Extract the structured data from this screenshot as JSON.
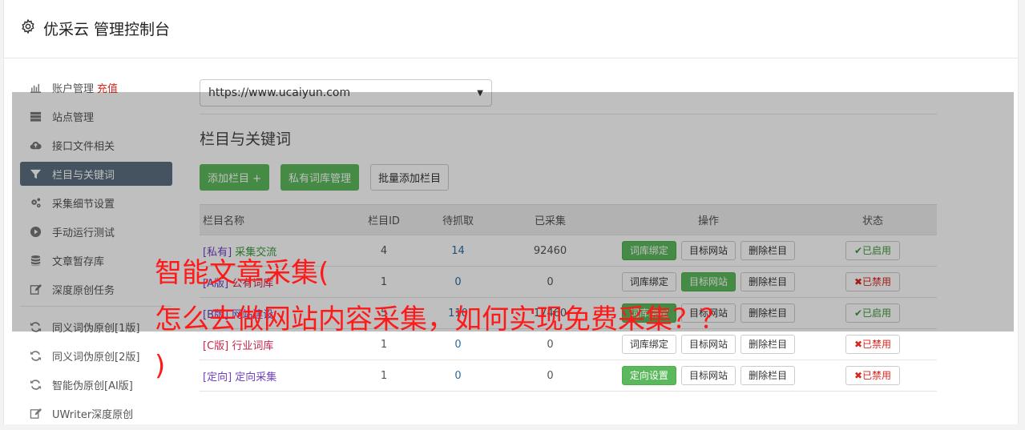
{
  "header": {
    "title": "优采云 管理控制台",
    "icon": "gear-icon"
  },
  "sidebar": {
    "items": [
      {
        "label": "账户管理",
        "extra": "充值",
        "icon": "bar-chart-icon"
      },
      {
        "label": "站点管理",
        "icon": "server-icon"
      },
      {
        "label": "接口文件相关",
        "icon": "cloud-upload-icon"
      },
      {
        "label": "栏目与关键词",
        "icon": "filter-icon",
        "active": true
      },
      {
        "label": "采集细节设置",
        "icon": "cogs-icon"
      },
      {
        "label": "手动运行测试",
        "icon": "play-circle-icon"
      },
      {
        "label": "文章暂存库",
        "icon": "database-icon"
      },
      {
        "label": "深度原创任务",
        "icon": "edit-icon"
      }
    ],
    "items2": [
      {
        "label": "同义词伪原创[1版]",
        "icon": "refresh-icon"
      },
      {
        "label": "同义词伪原创[2版]",
        "icon": "refresh-icon"
      },
      {
        "label": "智能伪原创[AI版]",
        "icon": "refresh-icon"
      },
      {
        "label": "UWriter深度原创",
        "icon": "edit-icon"
      }
    ]
  },
  "main": {
    "site_select": "https://www.ucaiyun.com",
    "section_title": "栏目与关键词",
    "buttons": {
      "add": "添加栏目 +",
      "private_lib": "私有词库管理",
      "batch_add": "批量添加栏目"
    },
    "table": {
      "headers": [
        "栏目名称",
        "栏目ID",
        "待抓取",
        "已采集",
        "操作",
        "状态"
      ],
      "rows": [
        {
          "tag": "[私有]",
          "name": "采集交流",
          "id": "4",
          "pending": "14",
          "collected": "92460",
          "actions": [
            "词库绑定",
            "目标网站",
            "删除栏目"
          ],
          "status": "已启用"
        },
        {
          "tag": "[A版]",
          "name": "公有词库",
          "id": "1",
          "pending": "0",
          "collected": "0",
          "actions": [
            "词库绑定",
            "目标网站",
            "删除栏目"
          ],
          "status": "已禁用"
        },
        {
          "tag": "[B版]",
          "name": "网站建设",
          "id": "5",
          "pending": "110",
          "collected": "17460",
          "actions": [
            "词库绑定",
            "目标网站",
            "删除栏目"
          ],
          "status": "已启用"
        },
        {
          "tag": "[C版]",
          "name": "行业词库",
          "id": "1",
          "pending": "0",
          "collected": "0",
          "actions": [
            "词库绑定",
            "目标网站",
            "删除栏目"
          ],
          "status": "已禁用"
        },
        {
          "tag": "[定向]",
          "name": "定向采集",
          "id": "1",
          "pending": "0",
          "collected": "0",
          "actions": [
            "定向设置",
            "目标网站",
            "删除栏目"
          ],
          "status": "已禁用"
        }
      ]
    }
  },
  "watermark": {
    "line1": "智能文章采集(",
    "line2": "怎么去做网站内容采集，如何实现免费采集？？",
    "line3": ")"
  },
  "colors": {
    "green": "#5cb85c",
    "active_nav": "#5b6f7f",
    "watermark": "#ff1a1a"
  }
}
